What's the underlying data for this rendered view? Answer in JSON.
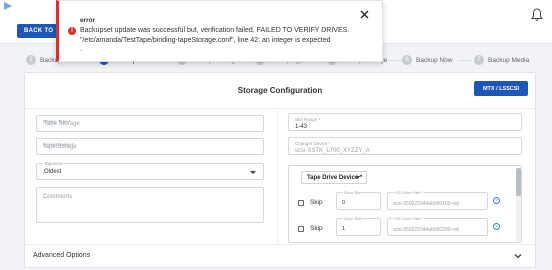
{
  "header": {
    "back_label": "BACK TO"
  },
  "stepper": {
    "steps": [
      {
        "num": "1",
        "label": "Backup Wizard"
      },
      {
        "num": "2",
        "label": "Backup Wizard"
      },
      {
        "num": "3",
        "label": "Backup Settings"
      },
      {
        "num": "4",
        "label": "Backup Type"
      },
      {
        "num": "5",
        "label": "Backup Storage"
      },
      {
        "num": "6",
        "label": "Backup Now"
      },
      {
        "num": "7",
        "label": "Backup Media"
      }
    ]
  },
  "card": {
    "title": "Storage Configuration",
    "mtx_button": "MTX / LSSCSI",
    "device_type": {
      "label": "Device Type *",
      "value": "Tape Storage"
    },
    "device_name": {
      "label": "Device Name *",
      "value": "tapeStorage"
    },
    "tapescan": {
      "label": "Tapescan",
      "value": "Oldest"
    },
    "comments": {
      "label": "Comments"
    },
    "slot_range": {
      "label": "Slot Range *",
      "value": "1-43"
    },
    "changer_device": {
      "label": "Changer Device *",
      "value": "scsi-SSTK_L700_XYZZY_A"
    },
    "drive_panel": {
      "select_label": "Tape Drive Device *",
      "rows": [
        {
          "skip": "Skip",
          "slot_label": "Drive Slot",
          "slot_value": "0",
          "path_label": "OS Drive Path *",
          "path_value": "scsi-350223344ab000100-nst"
        },
        {
          "skip": "Skip",
          "slot_label": "Drive Slot",
          "slot_value": "1",
          "path_label": "OS Drive Path *",
          "path_value": "scsi-350223344ab000200-nst"
        }
      ]
    },
    "advanced_label": "Advanced Options"
  },
  "toast": {
    "title": "error",
    "message": "Backupset update was successful but, verification failed. FAILED TO VERIFY DRIVES. \"/etc/amanda/TestTape/binding-tapeStorage.conf\", line 42: an integer is expected",
    "trail": "."
  },
  "colors": {
    "primary": "#1f57b8",
    "error": "#d32f2f"
  }
}
